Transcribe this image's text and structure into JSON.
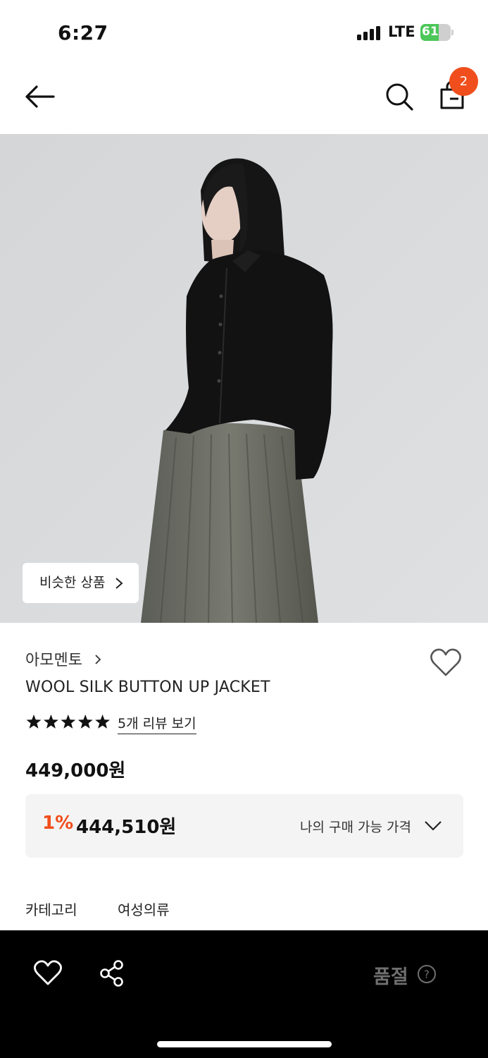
{
  "status_bar": {
    "time": "6:27",
    "network": "LTE",
    "battery": "61",
    "battery_level_percent": 61
  },
  "nav": {
    "cart_count": "2",
    "icons": [
      "back-arrow-icon",
      "search-icon",
      "shopping-bag-icon"
    ]
  },
  "product": {
    "similar_button": "비슷한 상품",
    "brand": "아모멘토",
    "name": "WOOL SILK BUTTON UP JACKET",
    "rating_stars": 5,
    "review_link": "5개 리뷰 보기",
    "price": "449,000원",
    "my_price": {
      "discount_rate": "1%",
      "discount_price": "444,510원",
      "label": "나의 구매 가능 가격"
    },
    "category": {
      "label": "카테고리",
      "value": "여성의류"
    }
  },
  "bottom_bar": {
    "soldout_label": "품절",
    "icons": [
      "heart-icon",
      "share-icon",
      "help-icon"
    ]
  },
  "colors": {
    "accent": "#f04e1c",
    "battery_green": "#4cc759",
    "bottom_bar": "#000000",
    "price_box": "#f4f4f4"
  }
}
